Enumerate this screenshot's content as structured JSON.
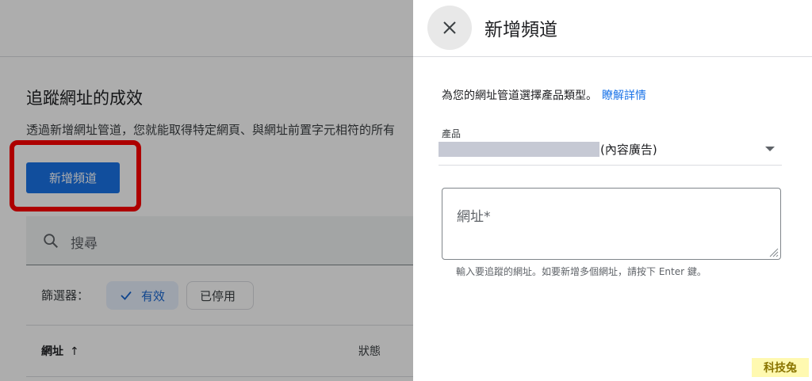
{
  "background": {
    "title": "追蹤網址的成效",
    "description": "透過新增網址管道，您就能取得特定網頁、與網址前置字元相符的所有",
    "add_button": "新增頻道",
    "search_placeholder": "搜尋",
    "filter_label": "篩選器：",
    "chips": {
      "active": "有效",
      "inactive": "已停用"
    },
    "table": {
      "col_url": "網址",
      "col_url_sort": "↑",
      "col_status": "狀態"
    }
  },
  "panel": {
    "title": "新增頻道",
    "intro_text": "為您的網址管道選擇產品類型。",
    "intro_link": "瞭解詳情",
    "product_label": "產品",
    "product_value": "(內容廣告)",
    "url_placeholder": "網址*",
    "helper_text": "輸入要追蹤的網址。如要新增多個網址，請按下 Enter 鍵。"
  },
  "watermark": "科技兔",
  "colors": {
    "accent": "#1a73e8",
    "highlight": "#ff0000",
    "chip_active_bg": "#e8f0fe"
  },
  "icons": [
    "search-icon",
    "check-icon",
    "close-icon",
    "dropdown-arrow-icon",
    "resize-grip-icon"
  ]
}
